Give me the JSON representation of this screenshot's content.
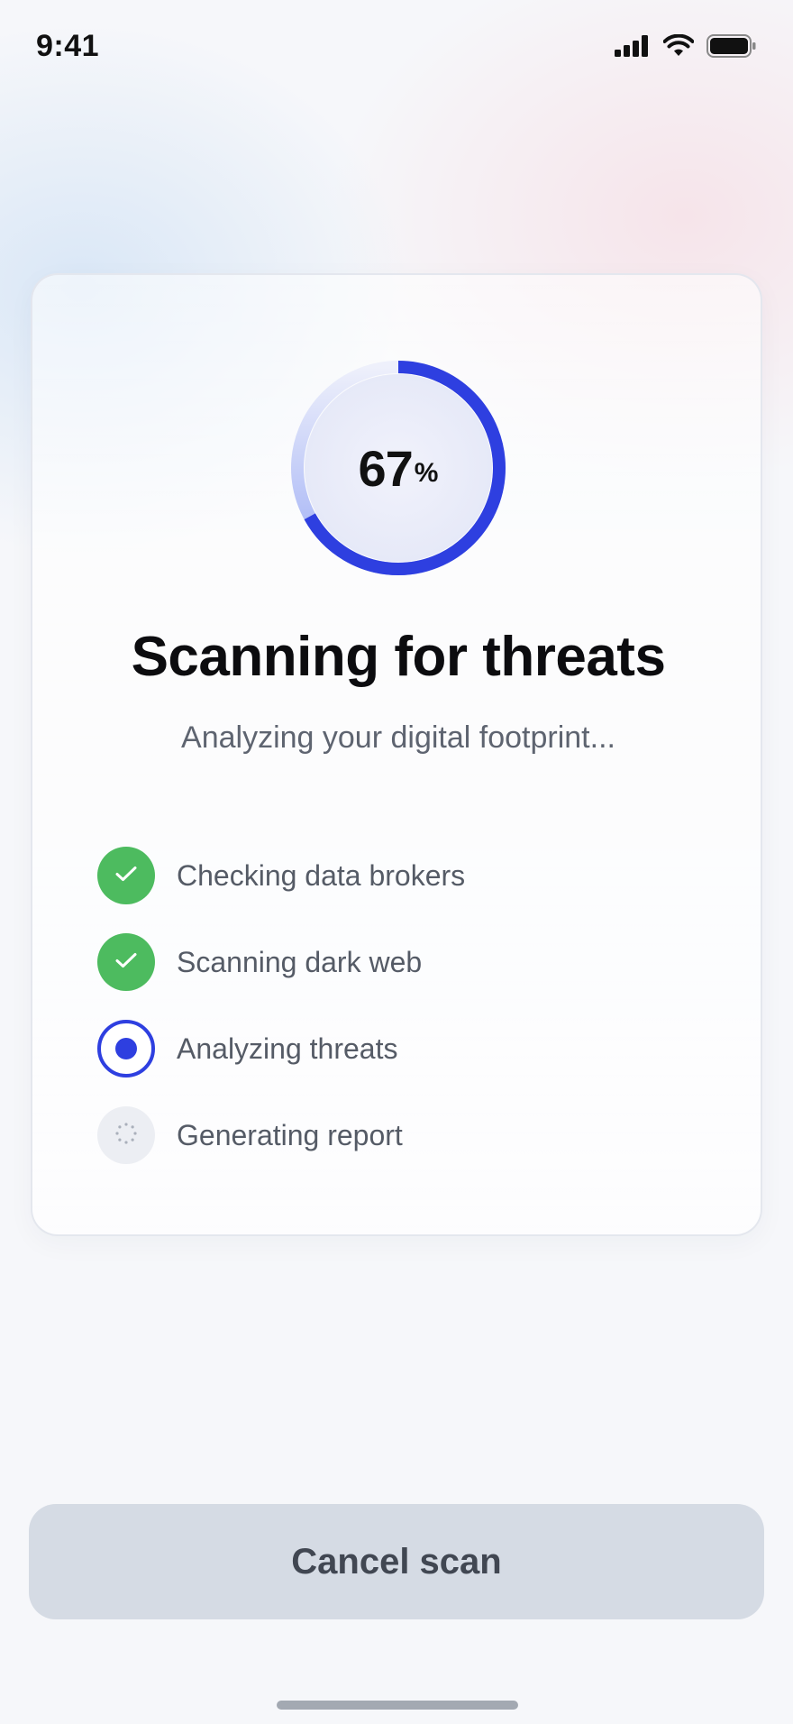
{
  "status_bar": {
    "time": "9:41"
  },
  "scan": {
    "progress_percent": 67,
    "progress_value": "67",
    "progress_sign": "%",
    "title": "Scanning for threats",
    "subtitle": "Analyzing your digital footprint...",
    "steps": [
      {
        "label": "Checking data brokers",
        "state": "complete",
        "icon": "check-icon"
      },
      {
        "label": "Scanning dark web",
        "state": "complete",
        "icon": "check-icon"
      },
      {
        "label": "Analyzing threats",
        "state": "in-progress",
        "icon": "radio-dot-icon"
      },
      {
        "label": "Generating report",
        "state": "pending",
        "icon": "loading-spinner-icon"
      }
    ]
  },
  "actions": {
    "cancel_label": "Cancel scan"
  },
  "colors": {
    "accent": "#2e3fe0",
    "success": "#4dbb5f",
    "button_bg": "#d5dbe4"
  }
}
